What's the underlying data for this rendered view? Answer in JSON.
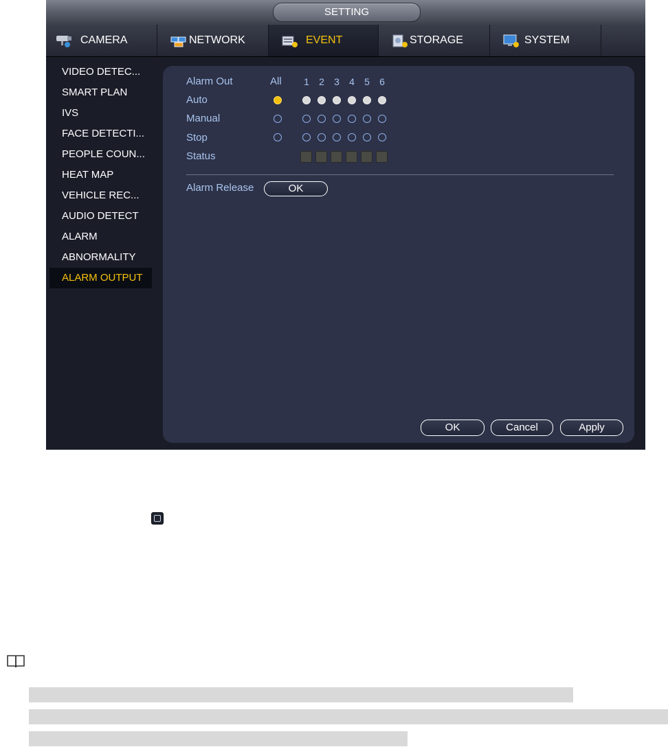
{
  "window": {
    "title": "SETTING"
  },
  "tabs": [
    {
      "label": "CAMERA",
      "icon": "camera-icon",
      "active": false
    },
    {
      "label": "NETWORK",
      "icon": "network-icon",
      "active": false
    },
    {
      "label": "EVENT",
      "icon": "event-icon",
      "active": true
    },
    {
      "label": "STORAGE",
      "icon": "storage-icon",
      "active": false
    },
    {
      "label": "SYSTEM",
      "icon": "system-icon",
      "active": false
    }
  ],
  "sidebar": {
    "items": [
      {
        "label": "VIDEO DETEC..."
      },
      {
        "label": "SMART PLAN"
      },
      {
        "label": "IVS"
      },
      {
        "label": "FACE DETECTI..."
      },
      {
        "label": "PEOPLE COUN..."
      },
      {
        "label": "HEAT MAP"
      },
      {
        "label": "VEHICLE REC..."
      },
      {
        "label": "AUDIO DETECT"
      },
      {
        "label": "ALARM"
      },
      {
        "label": "ABNORMALITY"
      },
      {
        "label": "ALARM OUTPUT",
        "active": true
      }
    ]
  },
  "alarm_out": {
    "header_label": "Alarm Out",
    "all_label": "All",
    "channels": [
      "1",
      "2",
      "3",
      "4",
      "5",
      "6"
    ],
    "rows": [
      {
        "label": "Auto",
        "all": "selected",
        "channels": [
          "on",
          "on",
          "on",
          "on",
          "on",
          "on"
        ]
      },
      {
        "label": "Manual",
        "all": "empty",
        "channels": [
          "empty",
          "empty",
          "empty",
          "empty",
          "empty",
          "empty"
        ]
      },
      {
        "label": "Stop",
        "all": "empty",
        "channels": [
          "empty",
          "empty",
          "empty",
          "empty",
          "empty",
          "empty"
        ]
      }
    ],
    "status_label": "Status",
    "status_count": 6
  },
  "alarm_release": {
    "label": "Alarm Release",
    "button": "OK"
  },
  "footer": {
    "ok": "OK",
    "cancel": "Cancel",
    "apply": "Apply"
  },
  "colors": {
    "accent": "#f2c10e",
    "panel": "#2d3248",
    "label": "#a9c3ee"
  }
}
